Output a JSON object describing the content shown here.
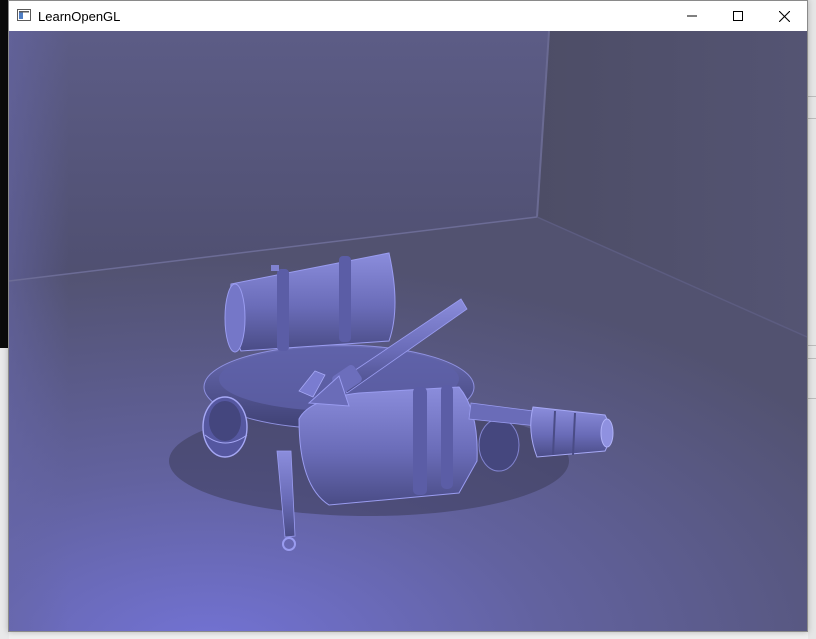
{
  "window": {
    "title": "LearnOpenGL",
    "icon": "app-window-icon",
    "controls": {
      "minimize": "minimize-icon",
      "maximize": "maximize-icon",
      "close": "close-icon"
    }
  },
  "scene": {
    "description_icon": "3d-render",
    "colors": {
      "light_tint": "#6e6ed6",
      "wall_back": "#57577a",
      "wall_right": "#4b4b63",
      "floor_near": "#7070cc",
      "model": "#6e70b8"
    }
  }
}
